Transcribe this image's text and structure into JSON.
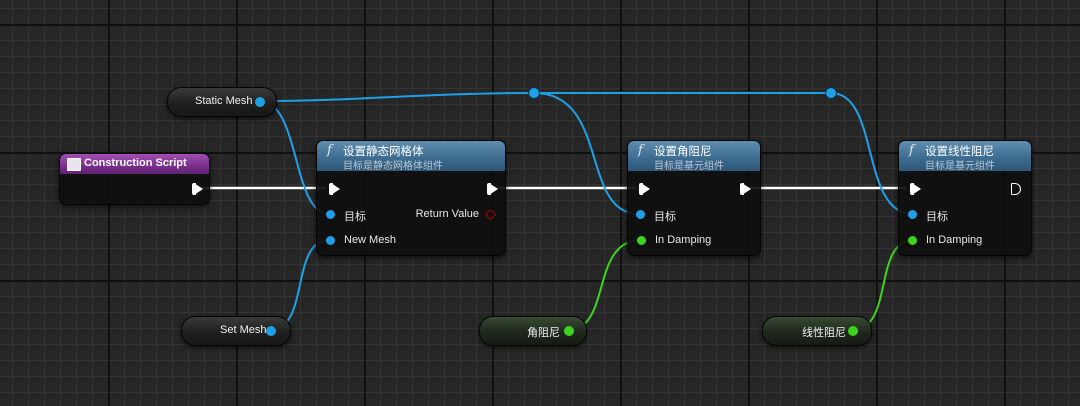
{
  "graph": {
    "event_node": {
      "title": "Construction Script",
      "icon": "function-graph-icon"
    },
    "var_static_mesh": {
      "label": "Static Mesh",
      "type": "object"
    },
    "var_set_mesh": {
      "label": "Set Mesh",
      "type": "object"
    },
    "var_angular": {
      "label": "角阻尼",
      "type": "float"
    },
    "var_linear": {
      "label": "线性阻尼",
      "type": "float"
    },
    "node_set_static_mesh": {
      "title": "设置静态网格体",
      "subtitle": "目标是静态网格体组件",
      "pin_target": "目标",
      "pin_new_mesh": "New Mesh",
      "pin_return": "Return Value"
    },
    "node_set_angular": {
      "title": "设置角阻尼",
      "subtitle": "目标是基元组件",
      "pin_target": "目标",
      "pin_damping": "In Damping"
    },
    "node_set_linear": {
      "title": "设置线性阻尼",
      "subtitle": "目标是基元组件",
      "pin_target": "目标",
      "pin_damping": "In Damping"
    },
    "function_glyph": "f"
  },
  "colors": {
    "object_pin": "#1ea0e6",
    "float_pin": "#3ed31c",
    "exec_wire": "#ffffff",
    "function_header": "#3b6a8e",
    "event_header": "#7a2e8e",
    "return_pin": "#b00000"
  }
}
